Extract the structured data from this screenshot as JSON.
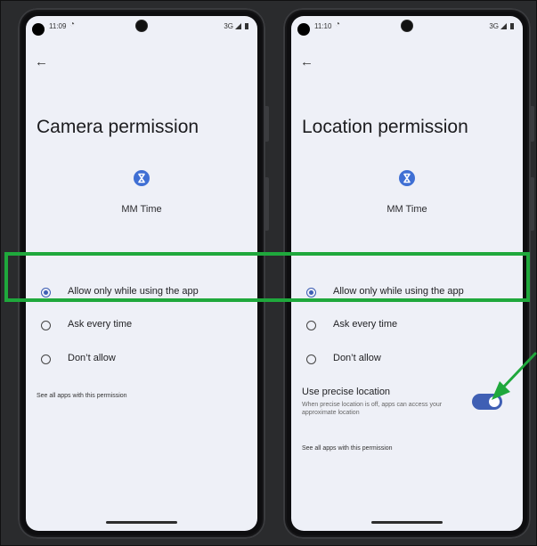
{
  "colors": {
    "highlight": "#1fa83c",
    "accent": "#3f5fb4",
    "screen_bg": "#eef0f7"
  },
  "left_screen": {
    "status": {
      "time": "11:09",
      "alarm_icon": "alarm-icon",
      "network": "3G"
    },
    "back_icon": "back-arrow-icon",
    "title": "Camera permission",
    "app_name": "MM Time",
    "options": [
      {
        "label": "Allow only while using the app",
        "selected": true
      },
      {
        "label": "Ask every time",
        "selected": false
      },
      {
        "label": "Don’t allow",
        "selected": false
      }
    ],
    "see_all": "See all apps with this permission"
  },
  "right_screen": {
    "status": {
      "time": "11:10",
      "alarm_icon": "alarm-icon",
      "network": "3G"
    },
    "back_icon": "back-arrow-icon",
    "title": "Location permission",
    "app_name": "MM Time",
    "options": [
      {
        "label": "Allow only while using the app",
        "selected": true
      },
      {
        "label": "Ask every time",
        "selected": false
      },
      {
        "label": "Don’t allow",
        "selected": false
      }
    ],
    "precise_location": {
      "title": "Use precise location",
      "description": "When precise location is off, apps can access your approximate location",
      "enabled": true
    },
    "see_all": "See all apps with this permission"
  }
}
